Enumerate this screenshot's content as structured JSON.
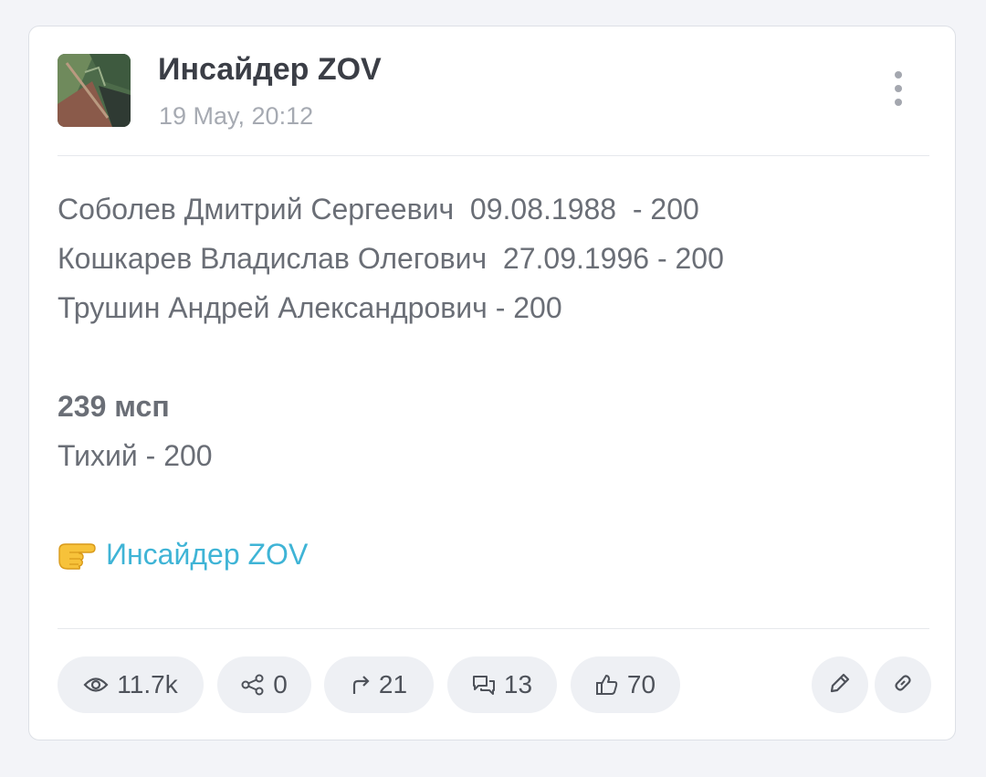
{
  "channel": {
    "title": "Инсайдер ZOV",
    "timestamp": "19 May, 20:12",
    "avatar_icon": "channel-avatar-image"
  },
  "post": {
    "lines": [
      "Соболев Дмитрий Сергеевич  09.08.1988  - 200",
      "Кошкарев Владислав Олегович  27.09.1996 - 200",
      "Трушин Андрей Александрович - 200"
    ],
    "unit_heading": "239 мсп",
    "unit_line": "Тихий - 200",
    "signature_emoji": "👉",
    "signature_link": "Инсайдер ZOV"
  },
  "stats": {
    "views": "11.7k",
    "shares": "0",
    "forwards": "21",
    "comments": "13",
    "reactions": "70"
  },
  "colors": {
    "accent_link": "#3fb4d6",
    "background": "#f3f4f8",
    "card": "#ffffff",
    "pill": "#eef0f4"
  },
  "icons": [
    "more-vertical-icon",
    "eye-icon",
    "share-nodes-icon",
    "forward-arrow-icon",
    "comments-icon",
    "thumbs-up-icon",
    "pencil-icon",
    "link-icon"
  ]
}
